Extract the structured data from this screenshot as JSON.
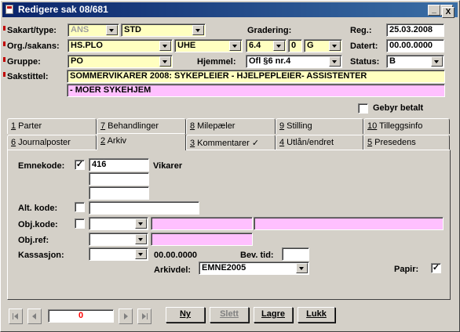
{
  "window": {
    "title": "Redigere sak 08/681",
    "minimize": "_",
    "maximize": "□",
    "close": "X"
  },
  "form": {
    "sakart_label": "Sakart/type:",
    "sakart_value": "ANS",
    "saktype_value": "STD",
    "gradering_label": "Gradering:",
    "reg_label": "Reg.:",
    "reg_value": "25.03.2008",
    "org_label": "Org./sakans:",
    "org_value": "HS.PLO",
    "sakans_value": "UHE",
    "code1_value": "6.4",
    "code2_value": "0",
    "code3_value": "G",
    "datert_label": "Datert:",
    "datert_value": "00.00.0000",
    "gruppe_label": "Gruppe:",
    "gruppe_value": "PO",
    "hjemmel_label": "Hjemmel:",
    "hjemmel_value": "Ofl §6 nr.4",
    "status_label": "Status:",
    "status_value": "B",
    "sakstittel_label": "Sakstittel:",
    "sakstittel_line1": "SOMMERVIKARER 2008: SYKEPLEIER - HJELPEPLEIER- ASSISTENTER",
    "sakstittel_line2": "- MOER SYKEHJEM",
    "gebyr_label": "Gebyr betalt"
  },
  "tabs_row1": [
    {
      "num": "1",
      "label": " Parter"
    },
    {
      "num": "7",
      "label": " Behandlinger"
    },
    {
      "num": "8",
      "label": " Milepæler"
    },
    {
      "num": "9",
      "label": " Stilling"
    },
    {
      "num": "10",
      "label": " Tilleggsinfo"
    }
  ],
  "tabs_row2": [
    {
      "num": "6",
      "label": " Journalposter"
    },
    {
      "num": "2",
      "label": " Arkiv"
    },
    {
      "num": "3",
      "label": " Kommentarer",
      "mark": "✓"
    },
    {
      "num": "4",
      "label": " Utlån/endret"
    },
    {
      "num": "5",
      "label": " Presedens"
    }
  ],
  "arkiv": {
    "emnekode_label": "Emnekode:",
    "emnekode_checked": "✓",
    "emnekode_value": "416",
    "emnekode_text": "Vikarer",
    "altkode_label": "Alt. kode:",
    "objkode_label": "Obj.kode:",
    "objref_label": "Obj.ref:",
    "kassasjon_label": "Kassasjon:",
    "kassasjon_date": "00.00.0000",
    "bevtid_label": "Bev. tid:",
    "arkivdel_label": "Arkivdel:",
    "arkivdel_value": "EMNE2005",
    "papir_label": "Papir:",
    "papir_checked": "✓"
  },
  "footer": {
    "record_counter": "0",
    "ny": "Ny",
    "slett": "Slett",
    "lagre": "Lagre",
    "lukk": "Lukk"
  }
}
